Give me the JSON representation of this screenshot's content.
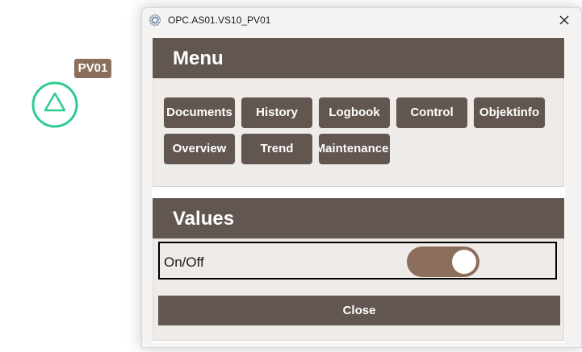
{
  "canvas": {
    "object_tag": "PV01",
    "object_symbol": "triangle-up-in-circle",
    "symbol_color": "#2ecc8f",
    "tag_color": "#8b6e5b"
  },
  "window": {
    "title": "OPC.AS01.VS10_PV01",
    "app_icon": "gear-icon",
    "close_icon": "close-icon"
  },
  "menu": {
    "header": "Menu",
    "buttons": [
      "Documents",
      "History",
      "Logbook",
      "Control",
      "Objektinfo",
      "Overview",
      "Trend",
      "Maintenance"
    ]
  },
  "values": {
    "header": "Values",
    "on_off": {
      "label": "On/Off",
      "state": true
    }
  },
  "footer": {
    "close_label": "Close"
  },
  "colors": {
    "header_bg": "#625650",
    "button_bg": "#625650",
    "panel_bg": "#efebe9",
    "toggle_on": "#8b6e5b"
  }
}
